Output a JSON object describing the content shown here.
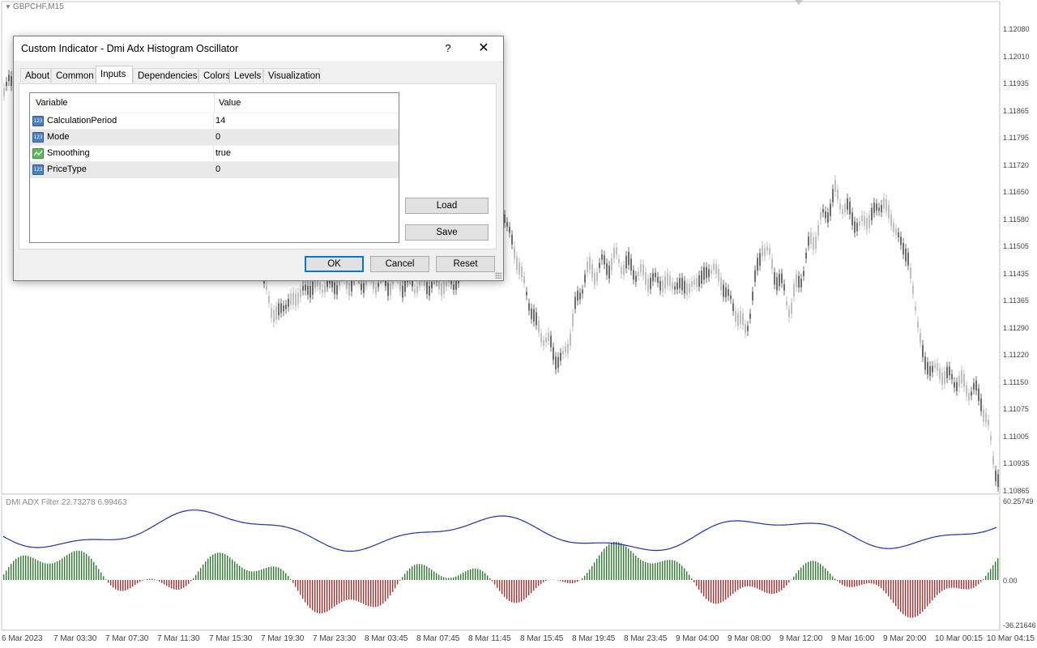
{
  "chart": {
    "symbol": "GBPCHF,M15",
    "price_axis": [
      "1.12080",
      "1.12010",
      "1.11935",
      "1.11865",
      "1.11795",
      "1.11720",
      "1.11650",
      "1.11580",
      "1.11505",
      "1.11435",
      "1.11365",
      "1.11290",
      "1.11220",
      "1.11150",
      "1.11075",
      "1.11005",
      "1.10935",
      "1.10865"
    ],
    "time_axis": [
      "6 Mar 2023",
      "7 Mar 03:30",
      "7 Mar 07:30",
      "7 Mar 11:30",
      "7 Mar 15:30",
      "7 Mar 19:30",
      "7 Mar 23:30",
      "8 Mar 03:45",
      "8 Mar 07:45",
      "8 Mar 11:45",
      "8 Mar 15:45",
      "8 Mar 19:45",
      "8 Mar 23:45",
      "9 Mar 04:00",
      "9 Mar 08:00",
      "9 Mar 12:00",
      "9 Mar 16:00",
      "9 Mar 20:00",
      "10 Mar 00:15",
      "10 Mar 04:15"
    ],
    "colors": {
      "bull": "#c0c0c0",
      "bear": "#6e6e6e",
      "histo_pos": "#2e7d2e",
      "histo_neg": "#b03030",
      "line": "#1f2fb0"
    }
  },
  "indicator": {
    "label": "DMI ADX Filter 22.73278 6.99463",
    "axis": [
      "60.25749",
      "0.00",
      "-36.21646"
    ]
  },
  "dialog": {
    "title": "Custom Indicator - Dmi Adx Histogram Oscillator",
    "help": "?",
    "close": "✕",
    "tabs": [
      "About",
      "Common",
      "Inputs",
      "Dependencies",
      "Colors",
      "Levels",
      "Visualization"
    ],
    "active_tab": "Inputs",
    "table": {
      "headers": [
        "Variable",
        "Value"
      ],
      "rows": [
        {
          "icon": "number-icon",
          "name": "CalculationPeriod",
          "value": "14"
        },
        {
          "icon": "number-icon",
          "name": "Mode",
          "value": "0"
        },
        {
          "icon": "boolean-icon",
          "name": "Smoothing",
          "value": "true"
        },
        {
          "icon": "number-icon",
          "name": "PriceType",
          "value": "0"
        }
      ]
    },
    "buttons": {
      "load": "Load",
      "save": "Save",
      "ok": "OK",
      "cancel": "Cancel",
      "reset": "Reset"
    }
  }
}
